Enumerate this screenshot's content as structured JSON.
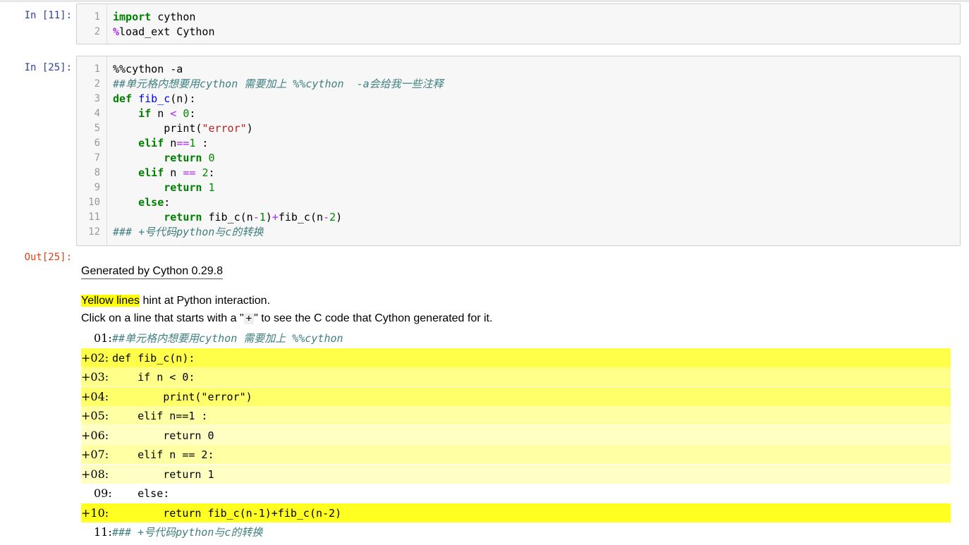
{
  "cells": [
    {
      "prompt": "In  [11]:",
      "line_numbers": [
        "1",
        "2"
      ],
      "lines": [
        "import cython",
        "%load_ext Cython"
      ]
    },
    {
      "prompt": "In  [25]:",
      "line_numbers": [
        "1",
        "2",
        "3",
        "4",
        "5",
        "6",
        "7",
        "8",
        "9",
        "10",
        "11",
        "12"
      ],
      "lines": [
        "%%cython -a",
        "##单元格内想要用cython 需要加上 %%cython  -a会给我一些注释",
        "def fib_c(n):",
        "    if n < 0:",
        "        print(\"error\")",
        "    elif n==1 :",
        "        return 0",
        "    elif n == 2:",
        "        return 1",
        "    else:",
        "        return fib_c(n-1)+fib_c(n-2)",
        "### +号代码python与c的转换"
      ]
    }
  ],
  "output": {
    "prompt": "Out[25]:",
    "generated_by": "Generated by Cython 0.29.8",
    "yellow_lines": "Yellow lines",
    "hint_rest": " hint at Python interaction.",
    "click_prefix": "Click on a line that starts with a \"",
    "plus": "+",
    "click_suffix": "\" to see the C code that Cython generated for it.",
    "annotated_lines": [
      {
        "num": "01:",
        "code": "##单元格内想要用cython 需要加上 %%cython",
        "color": "#ffffff"
      },
      {
        "num": "+02:",
        "code": "def fib_c(n):",
        "color": "#ffff4a"
      },
      {
        "num": "+03:",
        "code": "    if n < 0:",
        "color": "#ffff8a"
      },
      {
        "num": "+04:",
        "code": "        print(\"error\")",
        "color": "#ffff6a"
      },
      {
        "num": "+05:",
        "code": "    elif n==1 :",
        "color": "#ffffa4"
      },
      {
        "num": "+06:",
        "code": "        return 0",
        "color": "#ffffc4"
      },
      {
        "num": "+07:",
        "code": "    elif n == 2:",
        "color": "#ffffa4"
      },
      {
        "num": "+08:",
        "code": "        return 1",
        "color": "#ffffc4"
      },
      {
        "num": "09:",
        "code": "    else:",
        "color": "#ffffff"
      },
      {
        "num": "+10:",
        "code": "        return fib_c(n-1)+fib_c(n-2)",
        "color": "#ffff22"
      },
      {
        "num": "11:",
        "code": "### +号代码python与c的转换",
        "color": "#ffffff"
      }
    ]
  }
}
